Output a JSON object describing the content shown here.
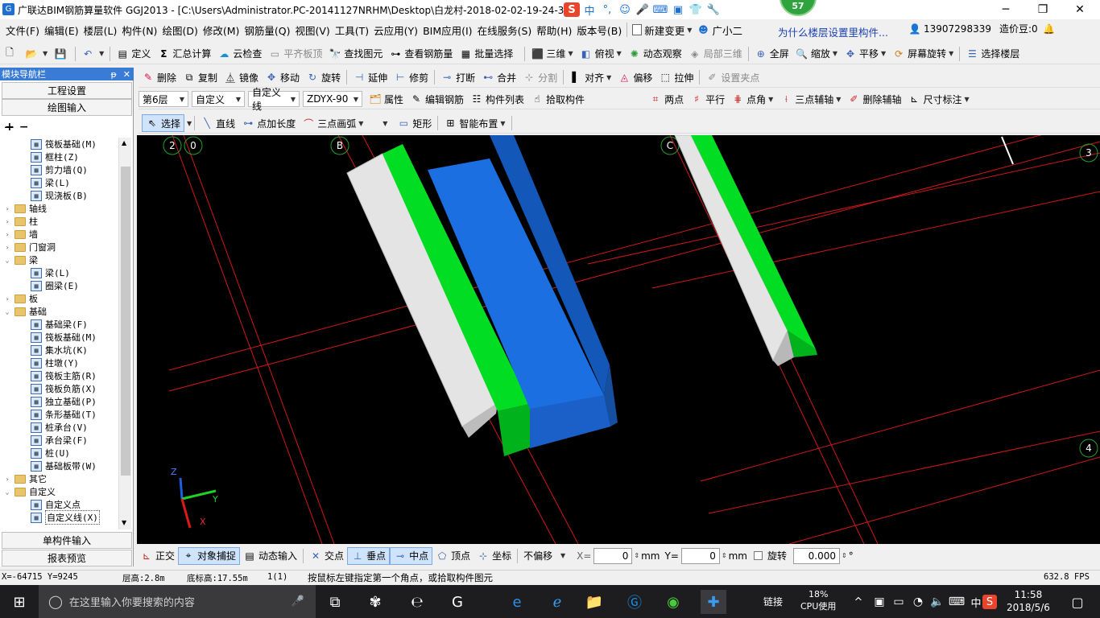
{
  "window": {
    "title": "广联达BIM钢筋算量软件 GGJ2013 - [C:\\Users\\Administrator.PC-20141127NRHM\\Desktop\\白龙村-2018-02-02-19-24-35",
    "badge": "57",
    "minimize": "─",
    "maximize": "❐",
    "close": "✕"
  },
  "ime": {
    "logo": "S",
    "lang": "中",
    "punct": "°,"
  },
  "menu": {
    "items": [
      "文件(F)",
      "编辑(E)",
      "楼层(L)",
      "构件(N)",
      "绘图(D)",
      "修改(M)",
      "钢筋量(Q)",
      "视图(V)",
      "工具(T)",
      "云应用(Y)",
      "BIM应用(I)",
      "在线服务(S)",
      "帮助(H)",
      "版本号(B)"
    ],
    "new_change": "新建变更",
    "assistant": "广小二",
    "tip": "为什么楼层设置里构件...",
    "phone": "13907298339",
    "price_bean": "造价豆:0"
  },
  "toolbar1": {
    "define": "定义",
    "sum": "汇总计算",
    "cloud_check": "云检查",
    "flat_top": "平齐板顶",
    "find": "查找图元",
    "view_rebar": "查看钢筋量",
    "batch_select": "批量选择",
    "three_d": "三维",
    "top_view": "俯视",
    "dynamic": "动态观察",
    "local_3d": "局部三维",
    "fullscreen": "全屏",
    "zoom": "缩放",
    "pan": "平移",
    "rotate_screen": "屏幕旋转",
    "select_floor": "选择楼层"
  },
  "toolbar2": {
    "delete": "删除",
    "copy": "复制",
    "mirror": "镜像",
    "move": "移动",
    "rotate": "旋转",
    "extend": "延伸",
    "trim": "修剪",
    "break": "打断",
    "merge": "合并",
    "split": "分割",
    "align": "对齐",
    "offset": "偏移",
    "stretch": "拉伸",
    "set_grip": "设置夹点"
  },
  "toolbar3": {
    "floor": "第6层",
    "type": "自定义",
    "line_type": "自定义线",
    "code": "ZDYX-90",
    "props": "属性",
    "edit_rebar": "编辑钢筋",
    "comp_list": "构件列表",
    "pick": "拾取构件",
    "two_point": "两点",
    "parallel": "平行",
    "point_angle": "点角",
    "three_point_axis": "三点辅轴",
    "delete_axis": "删除辅轴",
    "dimension": "尺寸标注"
  },
  "toolbar4": {
    "select": "选择",
    "line": "直线",
    "point_len": "点加长度",
    "arc": "三点画弧",
    "rect": "矩形",
    "smart": "智能布置"
  },
  "nav": {
    "title": "模块导航栏",
    "pin": "ᵽ",
    "close": "✕",
    "project_settings": "工程设置",
    "drawing_input": "绘图输入",
    "single_input": "单构件输入",
    "report": "报表预览",
    "tree": [
      {
        "level": 2,
        "label": "筏板基础(M)",
        "icon": "raft-icon"
      },
      {
        "level": 2,
        "label": "框柱(Z)",
        "icon": "column-icon"
      },
      {
        "level": 2,
        "label": "剪力墙(Q)",
        "icon": "wall-icon"
      },
      {
        "level": 2,
        "label": "梁(L)",
        "icon": "beam-icon"
      },
      {
        "level": 2,
        "label": "现浇板(B)",
        "icon": "slab-icon"
      },
      {
        "level": 1,
        "label": "轴线",
        "exp": ">"
      },
      {
        "level": 1,
        "label": "柱",
        "exp": ">"
      },
      {
        "level": 1,
        "label": "墙",
        "exp": ">"
      },
      {
        "level": 1,
        "label": "门窗洞",
        "exp": ">"
      },
      {
        "level": 1,
        "label": "梁",
        "exp": "v"
      },
      {
        "level": 2,
        "label": "梁(L)",
        "icon": "beam-icon"
      },
      {
        "level": 2,
        "label": "圈梁(E)",
        "icon": "ring-beam-icon"
      },
      {
        "level": 1,
        "label": "板",
        "exp": ">"
      },
      {
        "level": 1,
        "label": "基础",
        "exp": "v"
      },
      {
        "level": 2,
        "label": "基础梁(F)",
        "icon": "foundation-beam-icon"
      },
      {
        "level": 2,
        "label": "筏板基础(M)",
        "icon": "raft-icon"
      },
      {
        "level": 2,
        "label": "集水坑(K)",
        "icon": "sump-icon"
      },
      {
        "level": 2,
        "label": "柱墩(Y)",
        "icon": "pier-icon"
      },
      {
        "level": 2,
        "label": "筏板主筋(R)",
        "icon": "main-rebar-icon"
      },
      {
        "level": 2,
        "label": "筏板负筋(X)",
        "icon": "neg-rebar-icon"
      },
      {
        "level": 2,
        "label": "独立基础(P)",
        "icon": "isolated-footing-icon"
      },
      {
        "level": 2,
        "label": "条形基础(T)",
        "icon": "strip-footing-icon"
      },
      {
        "level": 2,
        "label": "桩承台(V)",
        "icon": "pile-cap-icon"
      },
      {
        "level": 2,
        "label": "承台梁(F)",
        "icon": "cap-beam-icon"
      },
      {
        "level": 2,
        "label": "桩(U)",
        "icon": "pile-icon"
      },
      {
        "level": 2,
        "label": "基础板带(W)",
        "icon": "band-icon"
      },
      {
        "level": 1,
        "label": "其它",
        "exp": ">"
      },
      {
        "level": 1,
        "label": "自定义",
        "exp": "v"
      },
      {
        "level": 2,
        "label": "自定义点",
        "icon": "custom-point-icon"
      },
      {
        "level": 2,
        "label": "自定义线(X)",
        "icon": "custom-line-icon",
        "selected": true
      }
    ]
  },
  "viewport": {
    "axis_labels": [
      "2",
      "0",
      "B",
      "C",
      "3",
      "4"
    ],
    "gizmo": {
      "z": "Z",
      "y": "Y",
      "x": "X"
    }
  },
  "snapbar": {
    "ortho": "正交",
    "object_snap": "对象捕捉",
    "dynamic_input": "动态输入",
    "intersection": "交点",
    "perpendicular": "垂点",
    "midpoint": "中点",
    "vertex": "顶点",
    "coordinate": "坐标",
    "offset_mode": "不偏移",
    "x_label": "X=",
    "x_value": "0",
    "y_label": "Y=",
    "y_value": "0",
    "unit": "mm",
    "rotate_label": "旋转",
    "rotate_value": "0.000",
    "degree": "°"
  },
  "status": {
    "coords": "X=-64715 Y=9245",
    "floor_height": "层高:2.8m",
    "base_height": "底标高:17.55m",
    "count": "1(1)",
    "hint": "按鼠标左键指定第一个角点，或拾取构件图元",
    "fps": "632.8 FPS"
  },
  "taskbar": {
    "search_placeholder": "在这里输入你要搜索的内容",
    "link": "链接",
    "cpu_pct": "18%",
    "cpu_label": "CPU使用",
    "ime_lang": "中",
    "time": "11:58",
    "date": "2018/5/6"
  },
  "colors": {
    "green": "#00dd22",
    "blue": "#1b6fe0",
    "white": "#e2e2e2",
    "grid_red": "#d01818"
  }
}
